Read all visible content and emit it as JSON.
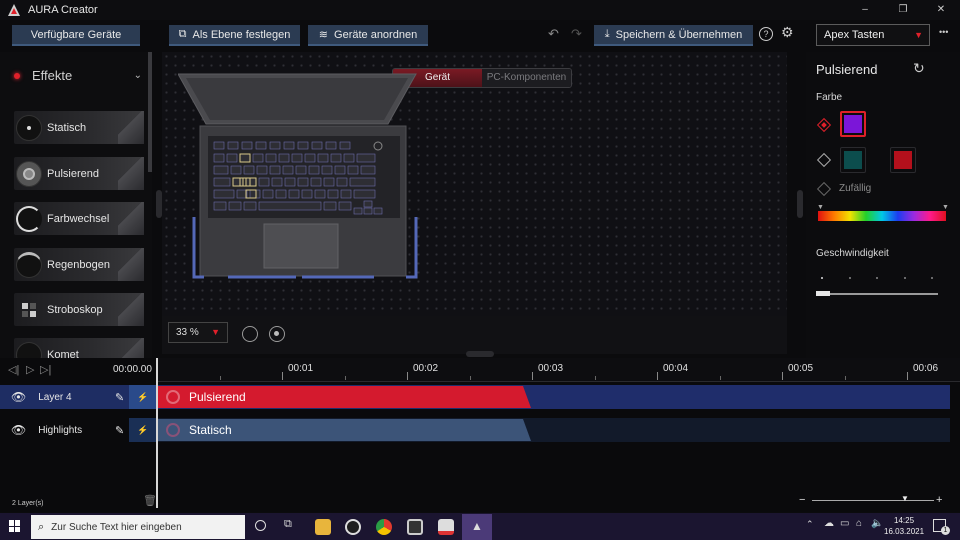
{
  "window": {
    "title": "AURA Creator",
    "controls": [
      "–",
      "❐",
      "✕"
    ]
  },
  "toolbar": {
    "devices_label": "Verfügbare Geräte",
    "set_layer_label": "Als Ebene festlegen",
    "arrange_label": "Geräte anordnen",
    "save_label": "Speichern & Übernehmen",
    "profile_value": "Apex Tasten",
    "more_label": "•••"
  },
  "effects": {
    "header": "Effekte",
    "items": [
      {
        "label": "Statisch",
        "icon": "static-icon"
      },
      {
        "label": "Pulsierend",
        "icon": "pulse-icon"
      },
      {
        "label": "Farbwechsel",
        "icon": "color-cycle-icon"
      },
      {
        "label": "Regenbogen",
        "icon": "rainbow-icon"
      },
      {
        "label": "Stroboskop",
        "icon": "strobe-icon"
      },
      {
        "label": "Komet",
        "icon": "comet-icon"
      }
    ]
  },
  "canvas": {
    "tabs": [
      {
        "label": "Gerät",
        "active": true
      },
      {
        "label": "PC-Komponenten",
        "active": false
      }
    ],
    "zoom": "33 %"
  },
  "properties": {
    "title": "Pulsierend",
    "color_label": "Farbe",
    "colors": {
      "selected": "#7b16d8",
      "option_a": "#0c4d4d",
      "option_b": "#b3101c"
    },
    "random_label": "Zufällig",
    "speed_label": "Geschwindigkeit",
    "speed_level": 0
  },
  "timeline": {
    "timecode": "00:00.00",
    "ticks": [
      "00:01",
      "00:02",
      "00:03",
      "00:04",
      "00:05",
      "00:06"
    ],
    "layers": [
      {
        "name": "Layer 4",
        "effect": "Pulsierend",
        "color": "#d41a2e",
        "track_color": "#1f2d6b"
      },
      {
        "name": "Highlights",
        "effect": "Statisch",
        "color": "#3c5478",
        "track_color": "#121a2a"
      }
    ],
    "layer_count": "2 Layer(s)"
  },
  "taskbar": {
    "search_placeholder": "Zur Suche Text hier eingeben",
    "time": "14:25",
    "date": "16.03.2021",
    "notification_count": "1"
  }
}
